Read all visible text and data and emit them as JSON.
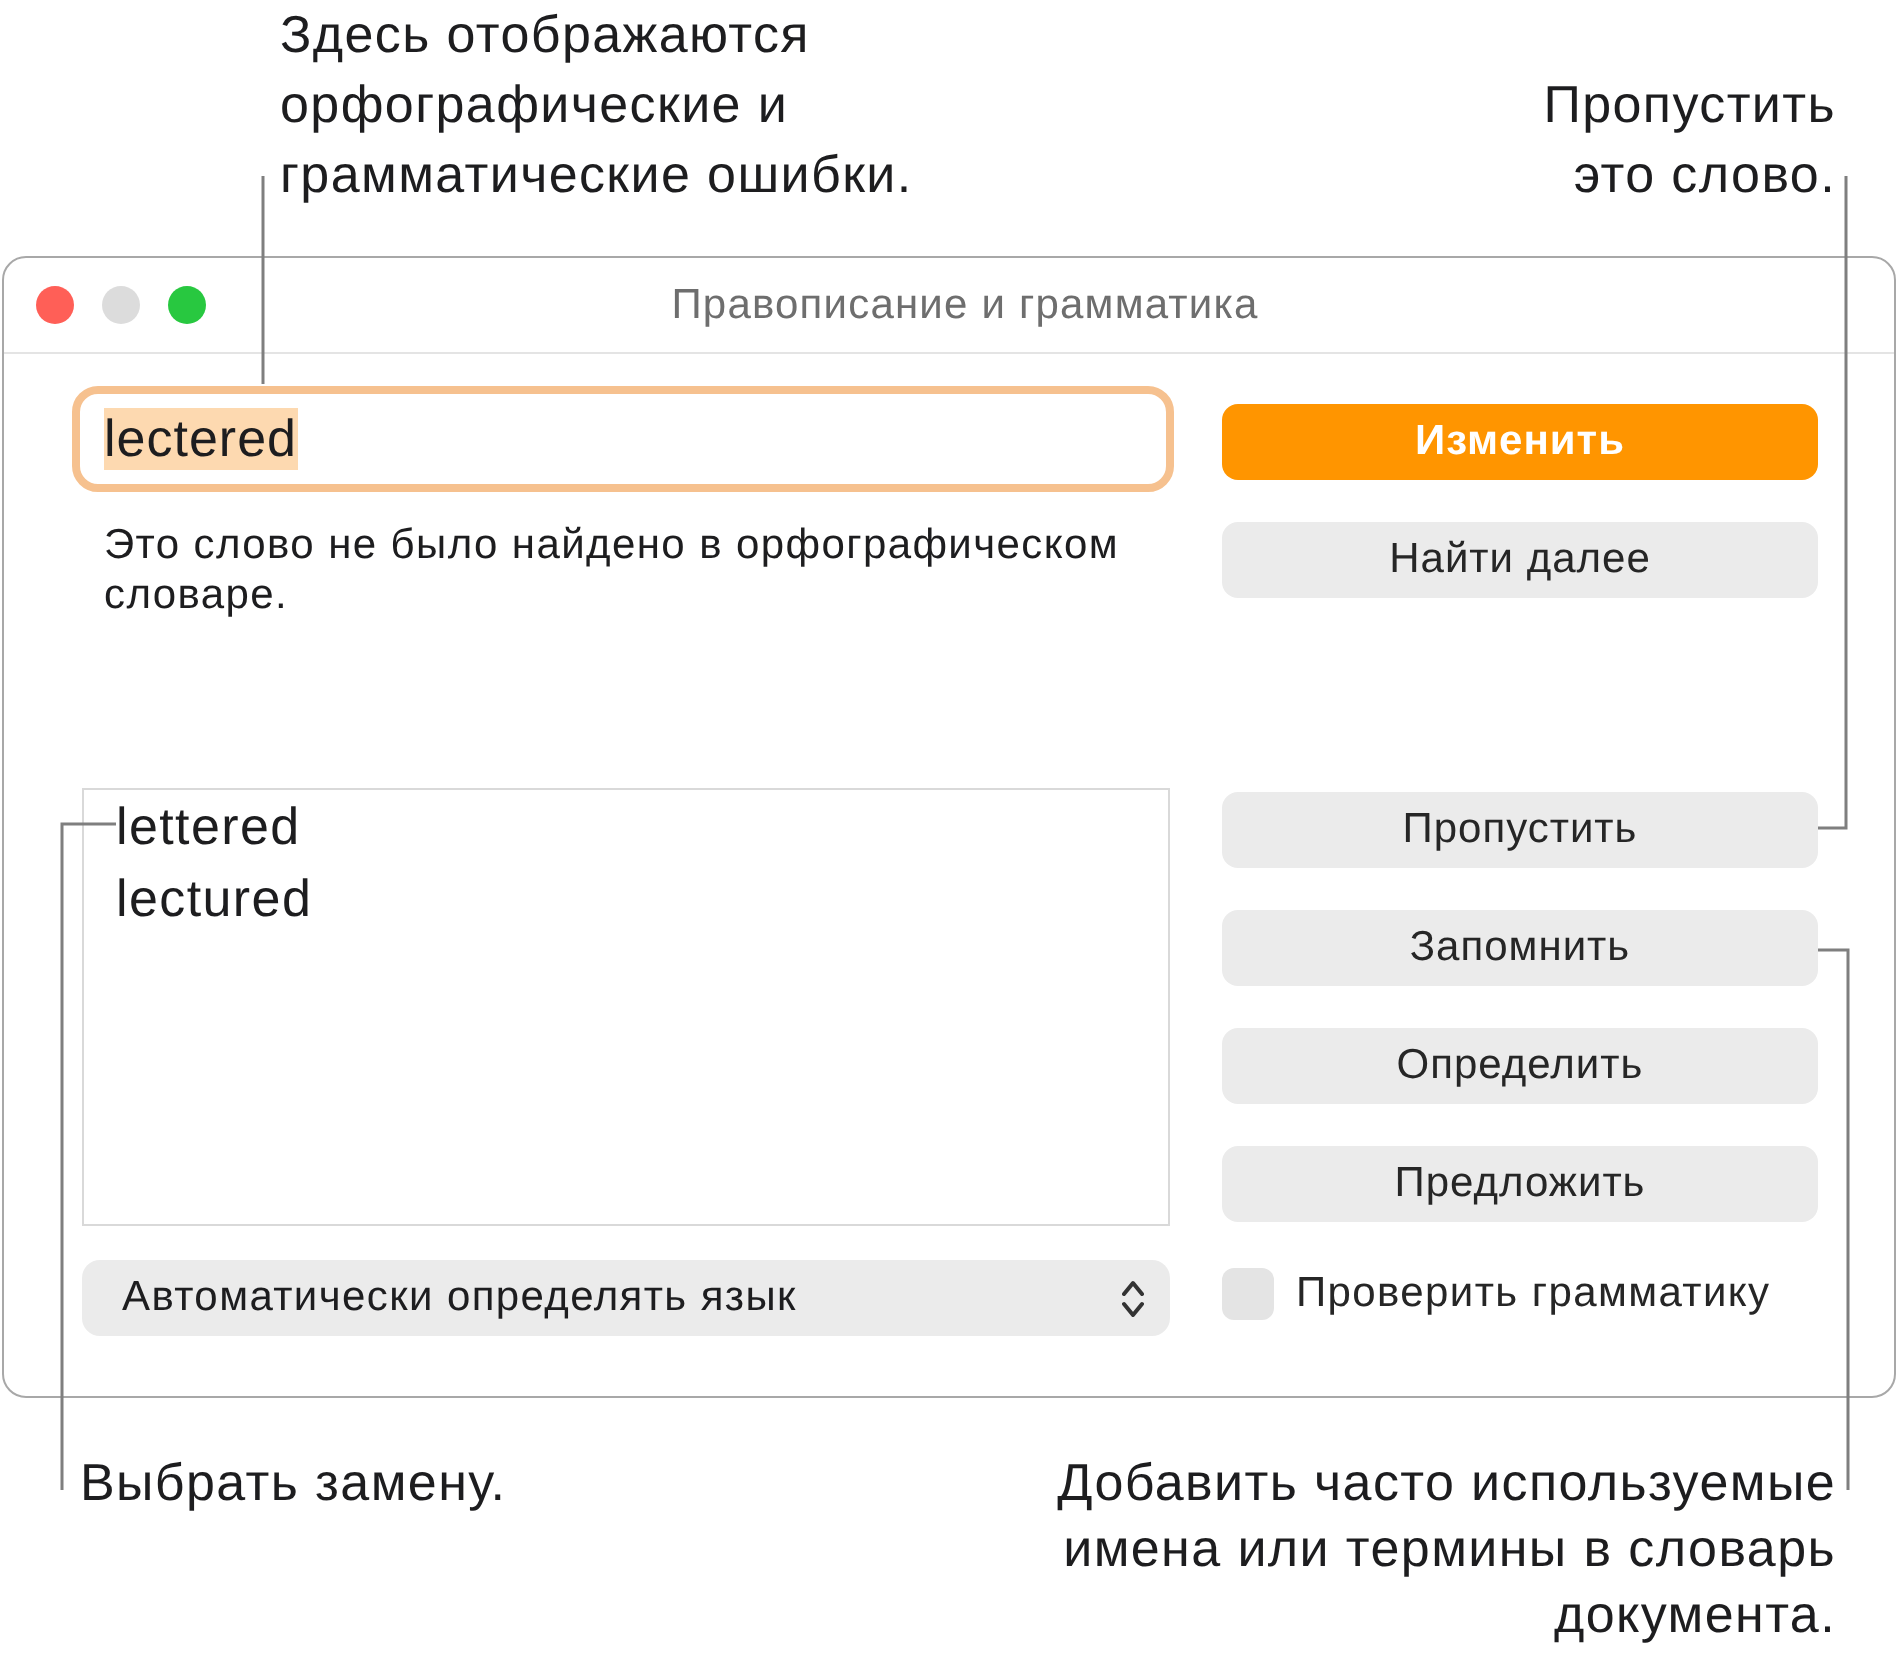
{
  "callouts_top": [
    "Здесь отображаются\nорфографические и\nграмматические ошибки.",
    "Пропустить\nэто слово."
  ],
  "window": {
    "title": "Правописание и грамматика",
    "controls": [
      {
        "kind": "close",
        "disabled": false
      },
      {
        "kind": "minimize",
        "disabled": true
      },
      {
        "kind": "zoom",
        "disabled": false
      }
    ]
  },
  "word_field": {
    "value": "lectered",
    "selected": true
  },
  "message": "Это слово не было найдено в орфографическом\nсловаре.",
  "suggestions": [
    {
      "label": "lettered",
      "selected": false
    },
    {
      "label": "lectured",
      "selected": false
    }
  ],
  "language_popup": {
    "value": "Автоматически определять язык"
  },
  "primary_buttons": [
    {
      "label": "Изменить",
      "default": true
    },
    {
      "label": "Найти далее",
      "default": false
    }
  ],
  "action_buttons": [
    {
      "label": "Пропустить",
      "default": false
    },
    {
      "label": "Запомнить",
      "default": false
    },
    {
      "label": "Определить",
      "default": false
    },
    {
      "label": "Предложить",
      "default": false
    }
  ],
  "grammar_check": {
    "label": "Проверить грамматику",
    "checked": false
  },
  "callouts_bottom": [
    "Выбрать замену.",
    "Добавить часто используемые\nимена или термины в словарь\nдокумента."
  ]
}
